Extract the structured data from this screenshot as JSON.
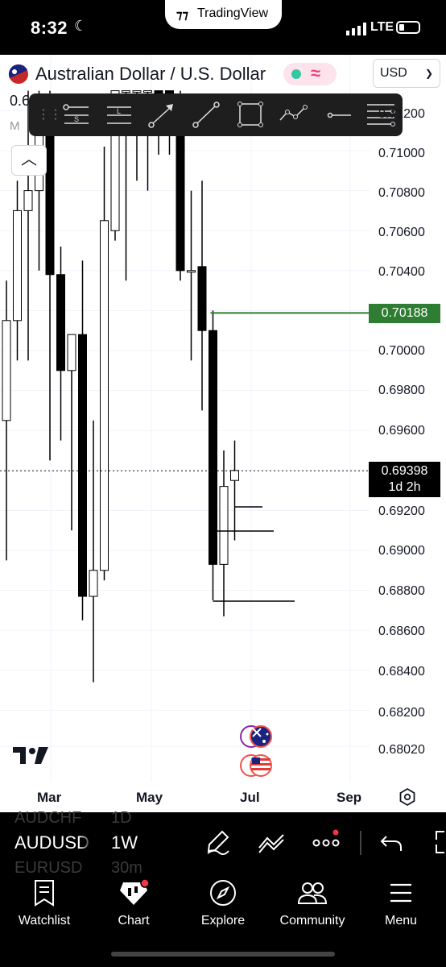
{
  "status_bar": {
    "time": "8:32",
    "app_pill": "TradingView",
    "network": "LTE"
  },
  "header": {
    "title": "Australian Dollar / U.S. Dollar",
    "currency": "USD",
    "partial_price": "0.6",
    "partial_label": "M"
  },
  "drawing_tools": [
    "horizontal-lines-S-icon",
    "horizontal-lines-L-icon",
    "arrow-icon",
    "trend-line-icon",
    "rectangle-icon",
    "path-icon",
    "horizontal-ray-icon",
    "fib-lines-icon"
  ],
  "price_axis": {
    "labels": [
      "0.71200",
      "0.71000",
      "0.70800",
      "0.70600",
      "0.70400",
      "0.70000",
      "0.69800",
      "0.69600",
      "0.69200",
      "0.69000",
      "0.68800",
      "0.68600",
      "0.68400",
      "0.68200",
      "0.68020"
    ],
    "alert_price": "0.70188",
    "current_price": "0.69398",
    "countdown": "1d 2h"
  },
  "chart_data": {
    "type": "candlestick",
    "symbol": "AUDUSD",
    "interval": "1W",
    "x_labels": [
      "Mar",
      "May",
      "Jul",
      "Sep"
    ],
    "ylim": [
      0.6795,
      0.713
    ],
    "horizontal_line": 0.70188,
    "last_price": 0.69398,
    "candles": [
      {
        "o": 0.6965,
        "h": 0.7035,
        "l": 0.6895,
        "c": 0.7015
      },
      {
        "o": 0.7015,
        "h": 0.7085,
        "l": 0.6995,
        "c": 0.707
      },
      {
        "o": 0.707,
        "h": 0.713,
        "l": 0.6995,
        "c": 0.708
      },
      {
        "o": 0.708,
        "h": 0.713,
        "l": 0.704,
        "c": 0.7115
      },
      {
        "o": 0.7125,
        "h": 0.713,
        "l": 0.6945,
        "c": 0.7038
      },
      {
        "o": 0.7038,
        "h": 0.7052,
        "l": 0.6955,
        "c": 0.699
      },
      {
        "o": 0.699,
        "h": 0.7002,
        "l": 0.691,
        "c": 0.7008
      },
      {
        "o": 0.7008,
        "h": 0.7045,
        "l": 0.6865,
        "c": 0.6877
      },
      {
        "o": 0.6877,
        "h": 0.6965,
        "l": 0.6834,
        "c": 0.689
      },
      {
        "o": 0.689,
        "h": 0.7102,
        "l": 0.6885,
        "c": 0.7065
      },
      {
        "o": 0.706,
        "h": 0.713,
        "l": 0.7055,
        "c": 0.713
      },
      {
        "o": 0.713,
        "h": 0.713,
        "l": 0.7035,
        "c": 0.713
      },
      {
        "o": 0.713,
        "h": 0.713,
        "l": 0.7085,
        "c": 0.713
      },
      {
        "o": 0.713,
        "h": 0.713,
        "l": 0.708,
        "c": 0.713
      },
      {
        "o": 0.713,
        "h": 0.713,
        "l": 0.7098,
        "c": 0.7125
      },
      {
        "o": 0.713,
        "h": 0.713,
        "l": 0.7098,
        "c": 0.7125
      },
      {
        "o": 0.7125,
        "h": 0.713,
        "l": 0.7035,
        "c": 0.704
      },
      {
        "o": 0.704,
        "h": 0.708,
        "l": 0.6995,
        "c": 0.704
      },
      {
        "o": 0.7042,
        "h": 0.7085,
        "l": 0.697,
        "c": 0.701
      },
      {
        "o": 0.701,
        "h": 0.702,
        "l": 0.6875,
        "c": 0.6893
      },
      {
        "o": 0.6893,
        "h": 0.695,
        "l": 0.6867,
        "c": 0.6932
      },
      {
        "o": 0.6935,
        "h": 0.6955,
        "l": 0.6905,
        "c": 0.694
      }
    ]
  },
  "symbol_bar": {
    "prev_symbol": "AUDCHF",
    "prev_interval": "1D",
    "symbol": "AUDUSD",
    "interval": "1W",
    "next_symbol": "EURUSD",
    "next_interval": "30m"
  },
  "tabs": [
    {
      "label": "Watchlist",
      "icon": "watchlist-icon"
    },
    {
      "label": "Chart",
      "icon": "chart-icon"
    },
    {
      "label": "Explore",
      "icon": "compass-icon"
    },
    {
      "label": "Community",
      "icon": "community-icon"
    },
    {
      "label": "Menu",
      "icon": "menu-icon"
    }
  ],
  "colors": {
    "alert_line": "#2e7d32",
    "bullish": "#ffffff",
    "bearish": "#000000",
    "status_dot": "#35c8a0",
    "notification": "#f23645"
  }
}
